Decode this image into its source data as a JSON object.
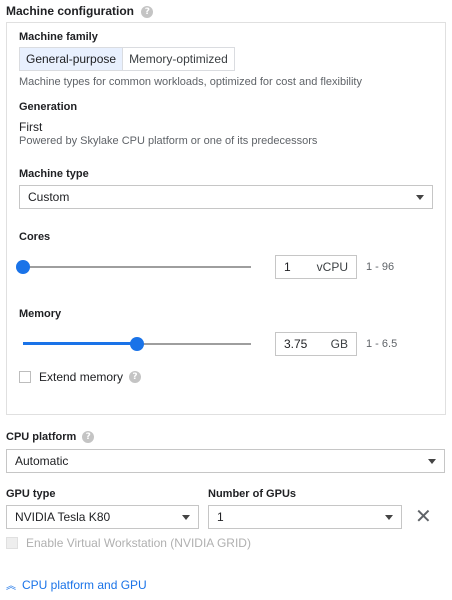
{
  "machine_configuration": {
    "title": "Machine configuration"
  },
  "machine_family": {
    "label": "Machine family",
    "tabs": [
      "General-purpose",
      "Memory-optimized"
    ],
    "selected": "General-purpose",
    "description": "Machine types for common workloads, optimized for cost and flexibility"
  },
  "generation": {
    "label": "Generation",
    "value": "First",
    "description": "Powered by Skylake CPU platform or one of its predecessors"
  },
  "machine_type": {
    "label": "Machine type",
    "value": "Custom"
  },
  "cores": {
    "label": "Cores",
    "value": "1",
    "unit": "vCPU",
    "range": "1 - 96",
    "level": 0.0
  },
  "memory": {
    "label": "Memory",
    "value": "3.75",
    "unit": "GB",
    "range": "1 - 6.5",
    "level": 0.5
  },
  "extend_memory": {
    "label": "Extend memory",
    "checked": false
  },
  "cpu_platform": {
    "label": "CPU platform",
    "value": "Automatic"
  },
  "gpu": {
    "type_label": "GPU type",
    "type_value": "NVIDIA Tesla K80",
    "count_label": "Number of GPUs",
    "count_value": "1",
    "workstation_label": "Enable Virtual Workstation (NVIDIA GRID)",
    "workstation_enabled": false
  },
  "collapse_link": {
    "label": "CPU platform and GPU"
  },
  "colors": {
    "accent": "#1a73e8",
    "track": "#9e9e9e",
    "selected_tab_bg": "#e8f0fe"
  },
  "icons": {
    "help": "help-icon",
    "close": "close-icon",
    "collapse": "double-chevron-up-icon",
    "dropdown": "caret-down-icon"
  }
}
